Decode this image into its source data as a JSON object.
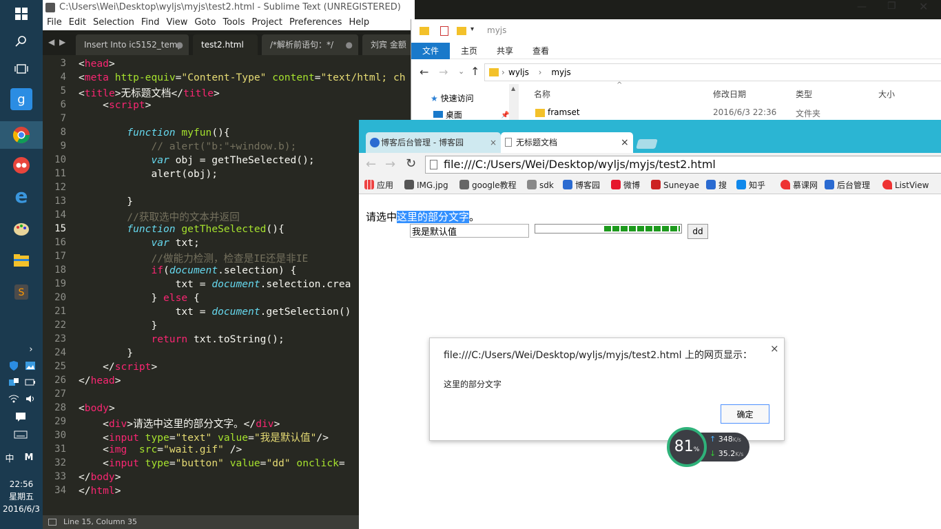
{
  "taskbar": {
    "clock_time": "22:56",
    "clock_day": "星期五",
    "clock_date": "2016/6/3",
    "ime_label": "中",
    "ime_mode": "M"
  },
  "sublime": {
    "title": "C:\\Users\\Wei\\Desktop\\wyljs\\myjs\\test2.html - Sublime Text (UNREGISTERED)",
    "menu": [
      "File",
      "Edit",
      "Selection",
      "Find",
      "View",
      "Goto",
      "Tools",
      "Project",
      "Preferences",
      "Help"
    ],
    "tabs": [
      "Insert Into ic5152_temp",
      "test2.html",
      "/*解析前语句：*/",
      "刘宾 金额"
    ],
    "line_numbers": [
      "3",
      "4",
      "5",
      "6",
      "7",
      "8",
      "9",
      "10",
      "11",
      "12",
      "13",
      "14",
      "15",
      "16",
      "17",
      "18",
      "19",
      "20",
      "21",
      "22",
      "23",
      "24",
      "25",
      "26",
      "27",
      "28",
      "29",
      "30",
      "31",
      "32",
      "33",
      "34"
    ],
    "status": "Line 15, Column 35",
    "code": {
      "l3_tag": "head",
      "l4_tag": "meta",
      "l4_attr1": "http-equiv",
      "l4_val1": "\"Content-Type\"",
      "l4_attr2": "content",
      "l4_val2": "\"text/html; ch",
      "l5_tag": "title",
      "l5_text": "无标题文档",
      "l6_tag": "script",
      "l8_kw": "function",
      "l8_fn": "myfun",
      "l8_rest": "(){",
      "l9_cm": "// alert(\"b:\"+window.b);",
      "l10_var": "var",
      "l10_rest": " obj = getTheSelected();",
      "l11_rest": "alert(obj);",
      "l13_rest": "}",
      "l14_cm": "//获取选中的文本并返回",
      "l15_kw": "function",
      "l15_fn": "getTheSelected",
      "l15_rest": "(){",
      "l16_var": "var",
      "l16_rest": " txt;",
      "l17_cm": "//做能力检测，检查是IE还是非IE",
      "l18_if": "if",
      "l18_doc": "document",
      "l18_rest": ".selection) {",
      "l19_a": "txt = ",
      "l19_doc": "document",
      "l19_rest": ".selection.crea",
      "l20_a": "} ",
      "l20_kw": "else",
      "l20_rest": " {",
      "l21_a": "txt = ",
      "l21_doc": "document",
      "l21_rest": ".getSelection()",
      "l22_rest": "}",
      "l23_kw": "return",
      "l23_rest": " txt.toString();",
      "l24_rest": "}",
      "l25_tag": "script",
      "l26_tag": "head",
      "l28_tag": "body",
      "l29_tag": "div",
      "l29_text": "请选中这里的部分文字。",
      "l30_tag": "input",
      "l30_attr1": "type",
      "l30_val1": "\"text\"",
      "l30_attr2": "value",
      "l30_val2": "\"我是默认值\"",
      "l31_tag": "img",
      "l31_attr1": "src",
      "l31_val1": "\"wait.gif\"",
      "l32_tag": "input",
      "l32_attr1": "type",
      "l32_val1": "\"button\"",
      "l32_attr2": "value",
      "l32_val2": "\"dd\"",
      "l32_attr3": "onclick",
      "l33_tag": "body",
      "l34_tag": "html"
    }
  },
  "explorer": {
    "title": "myjs",
    "ribbon_tabs": [
      "文件",
      "主页",
      "共享",
      "查看"
    ],
    "breadcrumb": [
      "wyljs",
      "myjs"
    ],
    "nav": [
      "快速访问",
      "桌面"
    ],
    "columns": [
      "名称",
      "修改日期",
      "类型",
      "大小"
    ],
    "rows": [
      {
        "name": "framset",
        "date": "2016/6/3 22:36",
        "type": "文件夹",
        "size": ""
      }
    ]
  },
  "chrome": {
    "tabs": [
      "博客后台管理 - 博客园",
      "无标题文档"
    ],
    "url": "file:///C:/Users/Wei/Desktop/wyljs/myjs/test2.html",
    "bookmarks": [
      "应用",
      "IMG.jpg",
      "google教程",
      "sdk",
      "博客园",
      "微博",
      "Suneyae",
      "搜",
      "知乎",
      "慕课网",
      "后台管理",
      "ListView"
    ],
    "page": {
      "text_before": "请选中",
      "text_selected": "这里的部分文字",
      "text_after": "。",
      "input_value": "我是默认值",
      "button_label": "dd"
    },
    "dialog": {
      "title": "file:///C:/Users/Wei/Desktop/wyljs/myjs/test2.html 上的网页显示：",
      "message": "这里的部分文字",
      "ok": "确定",
      "close": "×"
    }
  },
  "speed_widget": {
    "percent": "81",
    "percent_unit": "%",
    "upload": "348",
    "upload_unit": "K/s",
    "download": "35.2",
    "download_unit": "K/s"
  }
}
